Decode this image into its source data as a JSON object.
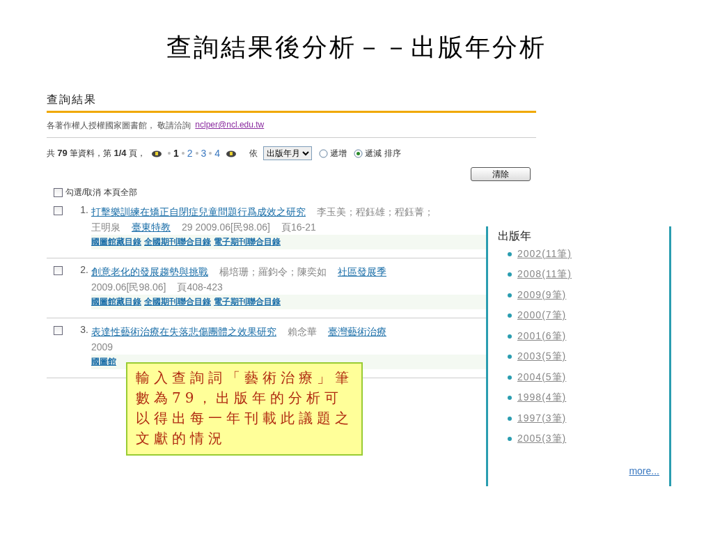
{
  "slide_title": "查詢結果後分析－－出版年分析",
  "panel": {
    "heading": "查詢結果",
    "notice": "各著作權人授權國家圖書館， 敬請洽詢",
    "email": "nclper@ncl.edu.tw",
    "summary": {
      "prefix": "共",
      "total": "79",
      "middle": "筆資料，第",
      "page": "1/4",
      "suffix": "頁，"
    },
    "pages": [
      {
        "label": "1",
        "selected": true
      },
      {
        "label": "2",
        "selected": false
      },
      {
        "label": "3",
        "selected": false
      },
      {
        "label": "4",
        "selected": false
      }
    ],
    "sort": {
      "by_label": "依",
      "field": "出版年月",
      "options": [
        {
          "label": "遞增",
          "selected": false
        },
        {
          "label": "遞減",
          "selected": true
        }
      ],
      "suffix": "排序"
    },
    "clear_button": "清除",
    "select_all": {
      "label": "勾選/取消 本頁全部",
      "checked": false
    },
    "results": [
      {
        "number": "1.",
        "checked": false,
        "lines": [
          [
            {
              "kind": "link",
              "text": "打擊樂訓練在矯正自閉症兒童問題行爲成效之研究"
            },
            {
              "kind": "text",
              "text": "李玉美；程鈺雄；程鈺菁；"
            }
          ],
          [
            {
              "kind": "text",
              "text": "王明泉"
            },
            {
              "kind": "link",
              "text": "臺東特教"
            },
            {
              "kind": "text",
              "text": "29 2009.06[民98.06]"
            },
            {
              "kind": "text",
              "text": "頁16-21"
            }
          ]
        ],
        "links": [
          "國圖館藏目錄",
          "全國期刊聯合目錄",
          "電子期刊聯合目錄"
        ]
      },
      {
        "number": "2.",
        "checked": false,
        "lines": [
          [
            {
              "kind": "link",
              "text": "創意老化的發展趨勢與挑戰"
            },
            {
              "kind": "text",
              "text": "楊培珊；羅鈞令；陳奕如"
            },
            {
              "kind": "link",
              "text": "社區發展季"
            }
          ],
          [
            {
              "kind": "text",
              "text": "2009.06[民98.06]"
            },
            {
              "kind": "text",
              "text": "頁408-423"
            }
          ]
        ],
        "links": [
          "國圖館藏目錄",
          "全國期刊聯合目錄",
          "電子期刊聯合目錄"
        ]
      },
      {
        "number": "3.",
        "checked": false,
        "lines": [
          [
            {
              "kind": "link",
              "text": "表達性藝術治療在失落悲傷團體之效果研究"
            },
            {
              "kind": "text",
              "text": "賴念華"
            },
            {
              "kind": "link",
              "text": "臺灣藝術治療"
            }
          ],
          [
            {
              "kind": "text",
              "text": "2009"
            }
          ]
        ],
        "links": [
          "國圖館"
        ]
      }
    ]
  },
  "year_facet": {
    "heading": "出版年",
    "items": [
      "2002(11筆)",
      "2008(11筆)",
      "2009(9筆)",
      "2000(7筆)",
      "2001(6筆)",
      "2003(5筆)",
      "2004(5筆)",
      "1998(4筆)",
      "1997(3筆)",
      "2005(3筆)"
    ],
    "more": "more..."
  },
  "callout": {
    "text": "輸入查詢詞「藝術治療」筆數為79，出版年的分析可以得出每一年刊載此議題之文獻的情況"
  }
}
